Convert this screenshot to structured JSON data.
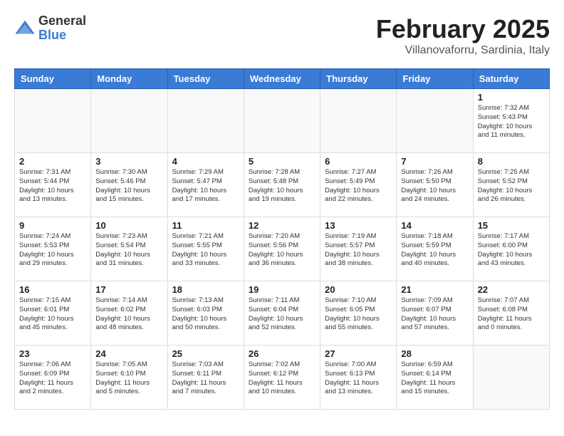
{
  "logo": {
    "general": "General",
    "blue": "Blue"
  },
  "header": {
    "month_year": "February 2025",
    "location": "Villanovaforru, Sardinia, Italy"
  },
  "days_of_week": [
    "Sunday",
    "Monday",
    "Tuesday",
    "Wednesday",
    "Thursday",
    "Friday",
    "Saturday"
  ],
  "weeks": [
    [
      {
        "day": "",
        "info": ""
      },
      {
        "day": "",
        "info": ""
      },
      {
        "day": "",
        "info": ""
      },
      {
        "day": "",
        "info": ""
      },
      {
        "day": "",
        "info": ""
      },
      {
        "day": "",
        "info": ""
      },
      {
        "day": "1",
        "info": "Sunrise: 7:32 AM\nSunset: 5:43 PM\nDaylight: 10 hours\nand 11 minutes."
      }
    ],
    [
      {
        "day": "2",
        "info": "Sunrise: 7:31 AM\nSunset: 5:44 PM\nDaylight: 10 hours\nand 13 minutes."
      },
      {
        "day": "3",
        "info": "Sunrise: 7:30 AM\nSunset: 5:46 PM\nDaylight: 10 hours\nand 15 minutes."
      },
      {
        "day": "4",
        "info": "Sunrise: 7:29 AM\nSunset: 5:47 PM\nDaylight: 10 hours\nand 17 minutes."
      },
      {
        "day": "5",
        "info": "Sunrise: 7:28 AM\nSunset: 5:48 PM\nDaylight: 10 hours\nand 19 minutes."
      },
      {
        "day": "6",
        "info": "Sunrise: 7:27 AM\nSunset: 5:49 PM\nDaylight: 10 hours\nand 22 minutes."
      },
      {
        "day": "7",
        "info": "Sunrise: 7:26 AM\nSunset: 5:50 PM\nDaylight: 10 hours\nand 24 minutes."
      },
      {
        "day": "8",
        "info": "Sunrise: 7:25 AM\nSunset: 5:52 PM\nDaylight: 10 hours\nand 26 minutes."
      }
    ],
    [
      {
        "day": "9",
        "info": "Sunrise: 7:24 AM\nSunset: 5:53 PM\nDaylight: 10 hours\nand 29 minutes."
      },
      {
        "day": "10",
        "info": "Sunrise: 7:23 AM\nSunset: 5:54 PM\nDaylight: 10 hours\nand 31 minutes."
      },
      {
        "day": "11",
        "info": "Sunrise: 7:21 AM\nSunset: 5:55 PM\nDaylight: 10 hours\nand 33 minutes."
      },
      {
        "day": "12",
        "info": "Sunrise: 7:20 AM\nSunset: 5:56 PM\nDaylight: 10 hours\nand 36 minutes."
      },
      {
        "day": "13",
        "info": "Sunrise: 7:19 AM\nSunset: 5:57 PM\nDaylight: 10 hours\nand 38 minutes."
      },
      {
        "day": "14",
        "info": "Sunrise: 7:18 AM\nSunset: 5:59 PM\nDaylight: 10 hours\nand 40 minutes."
      },
      {
        "day": "15",
        "info": "Sunrise: 7:17 AM\nSunset: 6:00 PM\nDaylight: 10 hours\nand 43 minutes."
      }
    ],
    [
      {
        "day": "16",
        "info": "Sunrise: 7:15 AM\nSunset: 6:01 PM\nDaylight: 10 hours\nand 45 minutes."
      },
      {
        "day": "17",
        "info": "Sunrise: 7:14 AM\nSunset: 6:02 PM\nDaylight: 10 hours\nand 48 minutes."
      },
      {
        "day": "18",
        "info": "Sunrise: 7:13 AM\nSunset: 6:03 PM\nDaylight: 10 hours\nand 50 minutes."
      },
      {
        "day": "19",
        "info": "Sunrise: 7:11 AM\nSunset: 6:04 PM\nDaylight: 10 hours\nand 52 minutes."
      },
      {
        "day": "20",
        "info": "Sunrise: 7:10 AM\nSunset: 6:05 PM\nDaylight: 10 hours\nand 55 minutes."
      },
      {
        "day": "21",
        "info": "Sunrise: 7:09 AM\nSunset: 6:07 PM\nDaylight: 10 hours\nand 57 minutes."
      },
      {
        "day": "22",
        "info": "Sunrise: 7:07 AM\nSunset: 6:08 PM\nDaylight: 11 hours\nand 0 minutes."
      }
    ],
    [
      {
        "day": "23",
        "info": "Sunrise: 7:06 AM\nSunset: 6:09 PM\nDaylight: 11 hours\nand 2 minutes."
      },
      {
        "day": "24",
        "info": "Sunrise: 7:05 AM\nSunset: 6:10 PM\nDaylight: 11 hours\nand 5 minutes."
      },
      {
        "day": "25",
        "info": "Sunrise: 7:03 AM\nSunset: 6:11 PM\nDaylight: 11 hours\nand 7 minutes."
      },
      {
        "day": "26",
        "info": "Sunrise: 7:02 AM\nSunset: 6:12 PM\nDaylight: 11 hours\nand 10 minutes."
      },
      {
        "day": "27",
        "info": "Sunrise: 7:00 AM\nSunset: 6:13 PM\nDaylight: 11 hours\nand 13 minutes."
      },
      {
        "day": "28",
        "info": "Sunrise: 6:59 AM\nSunset: 6:14 PM\nDaylight: 11 hours\nand 15 minutes."
      },
      {
        "day": "",
        "info": ""
      }
    ]
  ]
}
